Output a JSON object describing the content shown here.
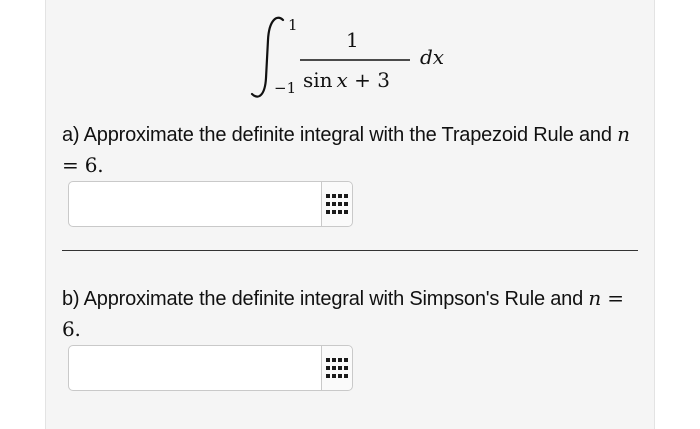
{
  "integral": {
    "upper_limit": "1",
    "lower_limit": "−1",
    "numerator": "1",
    "denominator_fn": "sin",
    "denominator_var": "x",
    "denominator_rest": " + 3",
    "differential": "dx"
  },
  "question_a": {
    "text_before": "a) Approximate the definite integral with the Trapezoid Rule and ",
    "math_var": "n",
    "math_rest": " = 6."
  },
  "question_b": {
    "text_before": "b) Approximate the definite integral with Simpson's Rule and ",
    "math_var": "n",
    "math_rest": " = 6."
  },
  "answer_a": {
    "value": "",
    "keypad_icon": "keypad-grid-icon"
  },
  "answer_b": {
    "value": "",
    "keypad_icon": "keypad-grid-icon"
  },
  "colors": {
    "card_background": "#f5f5f5",
    "field_border": "#c9c9c9",
    "divider": "#333333"
  }
}
